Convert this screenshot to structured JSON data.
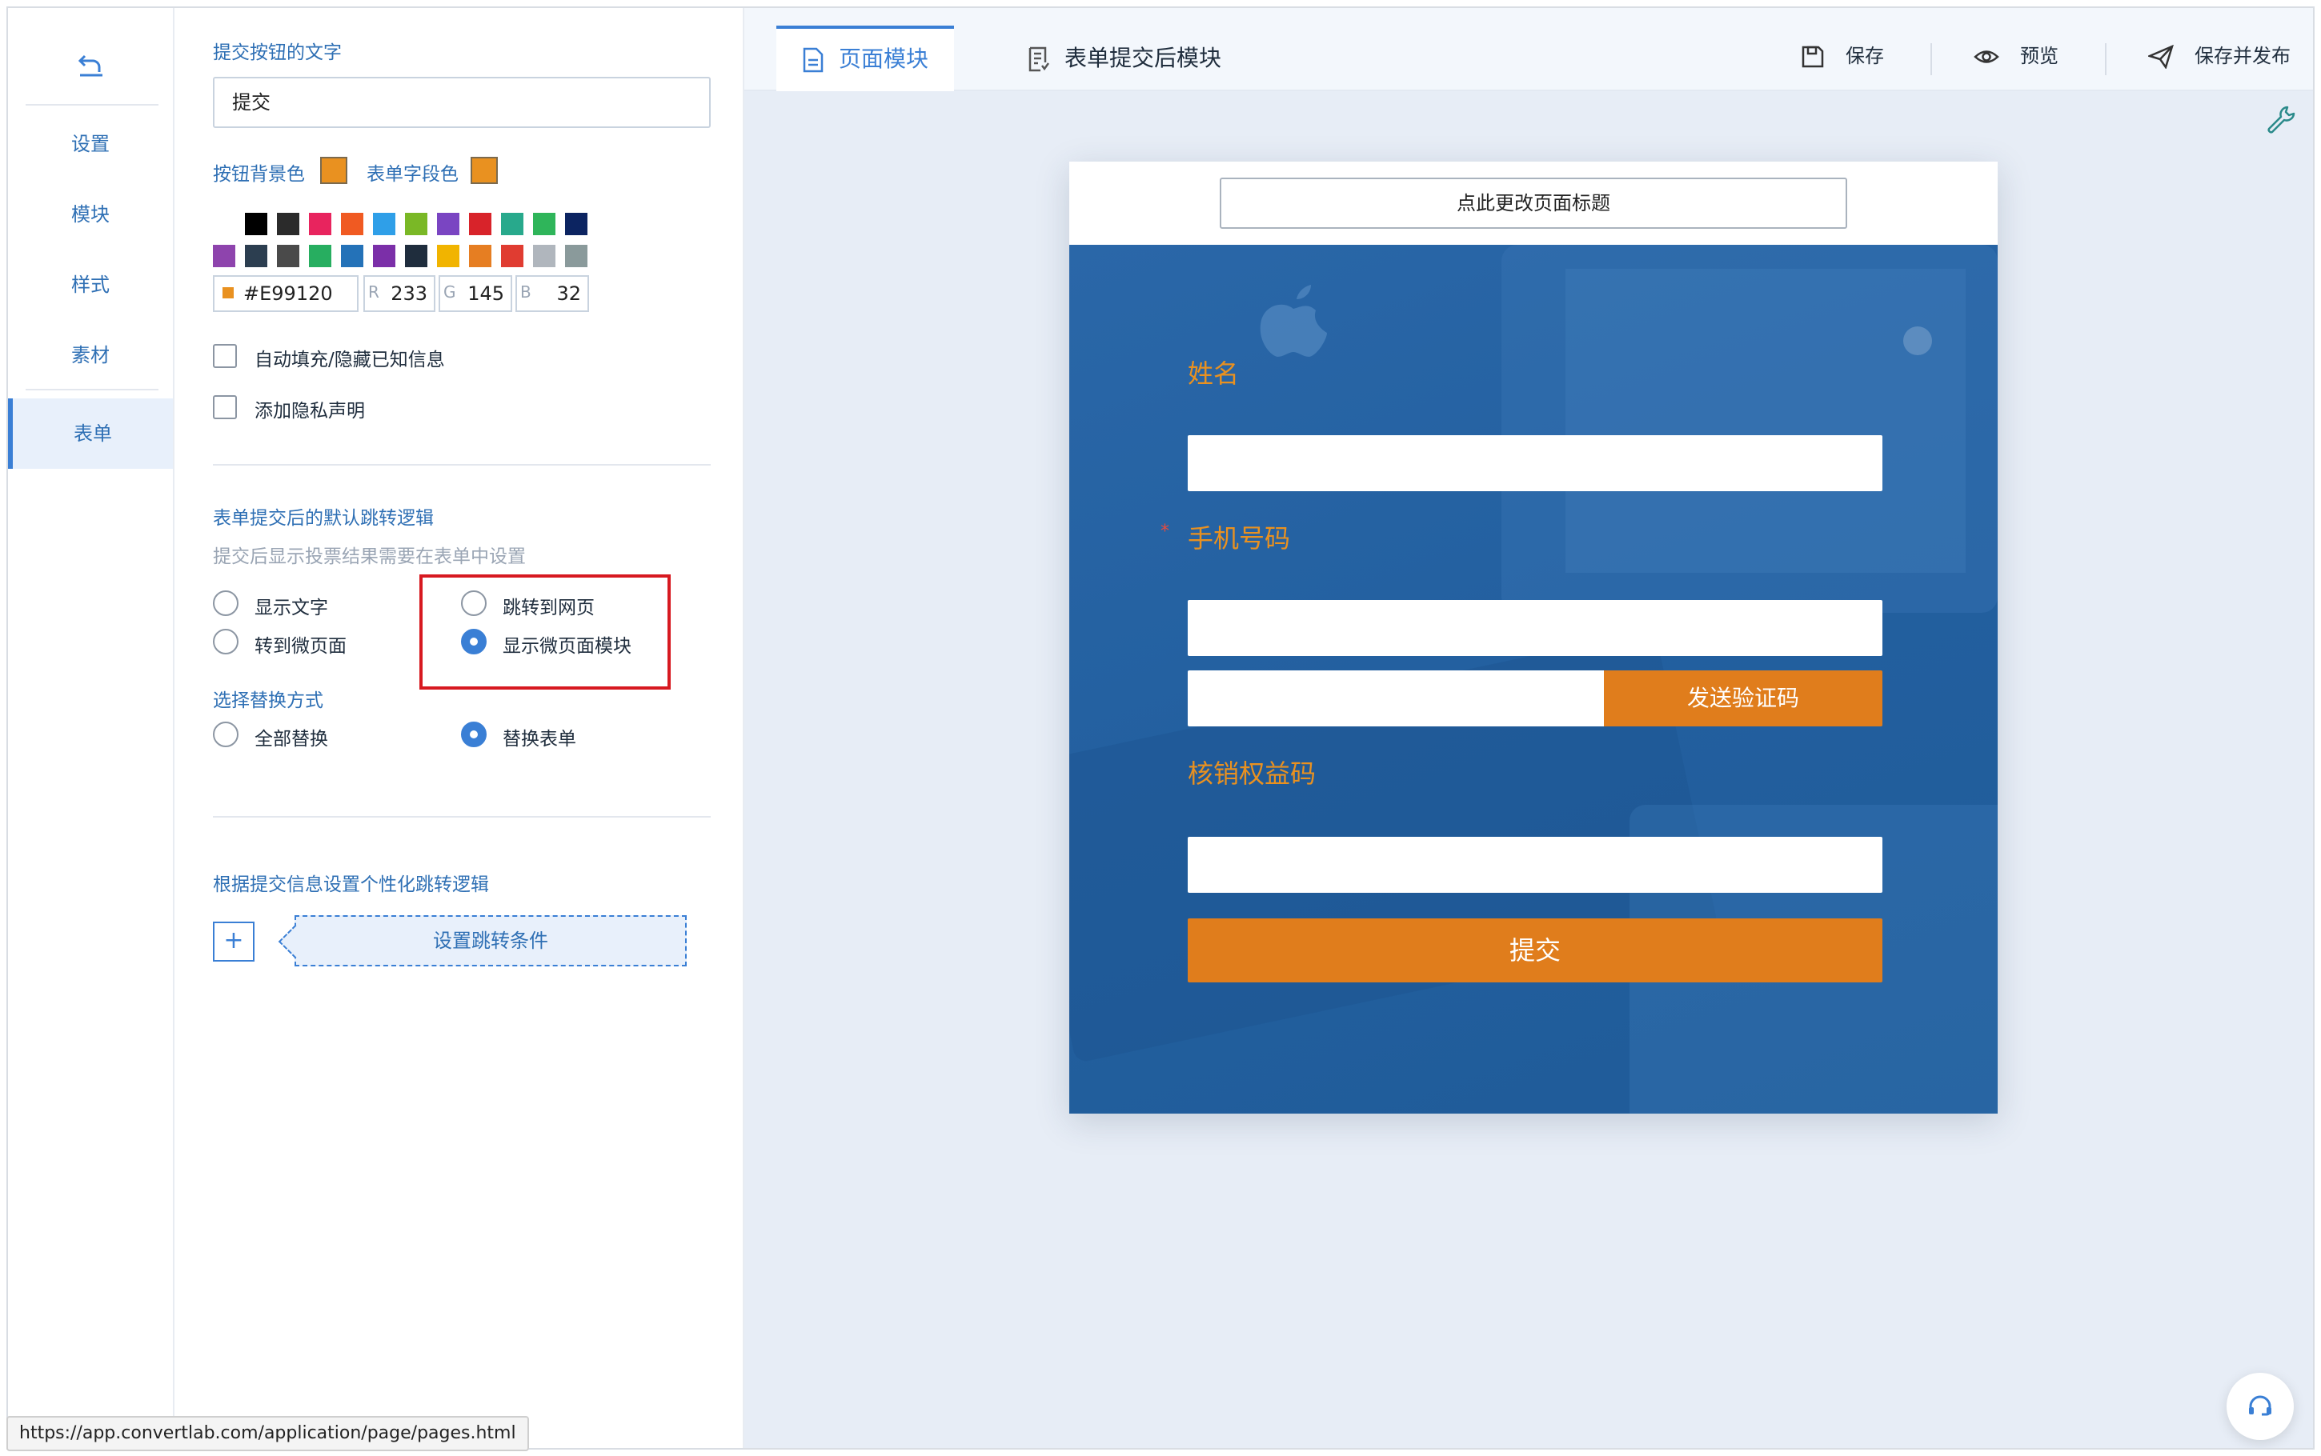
{
  "nav": {
    "items": [
      {
        "label": "设置"
      },
      {
        "label": "模块"
      },
      {
        "label": "样式"
      },
      {
        "label": "素材"
      },
      {
        "label": "表单",
        "active": true
      }
    ]
  },
  "panel": {
    "submit_text_label": "提交按钮的文字",
    "submit_text_value": "提交",
    "btn_bg_label": "按钮背景色",
    "field_color_label": "表单字段色",
    "btn_bg_color": "#E99120",
    "field_color": "#E99120",
    "palette_row1": [
      "#ffffff",
      "#000000",
      "#2b2b2b",
      "#e8245e",
      "#f05a22",
      "#2f9fe8",
      "#7ab826",
      "#7a45c2",
      "#d8232a",
      "#28a98c",
      "#2fb55a",
      "#0c2461"
    ],
    "palette_row2": [
      "#8e44ad",
      "#2c3e50",
      "#4a4a4a",
      "#27ae60",
      "#2472b8",
      "#7b2fa8",
      "#1f2d3d",
      "#f1b400",
      "#e67e22",
      "#e03c31",
      "#b0b6bd",
      "#8a9a9b"
    ],
    "hex_value": "#E99120",
    "r_label": "R",
    "r_value": "233",
    "g_label": "G",
    "g_value": "145",
    "b_label": "B",
    "b_value": "32",
    "autofill_label": "自动填充/隐藏已知信息",
    "privacy_label": "添加隐私声明",
    "redirect_title": "表单提交后的默认跳转逻辑",
    "redirect_hint": "提交后显示投票结果需要在表单中设置",
    "opt_show_text": "显示文字",
    "opt_goto_web": "跳转到网页",
    "opt_goto_micro": "转到微页面",
    "opt_show_module": "显示微页面模块",
    "replace_title": "选择替换方式",
    "opt_replace_all": "全部替换",
    "opt_replace_form": "替换表单",
    "personal_title": "根据提交信息设置个性化跳转逻辑",
    "plus_label": "+",
    "condition_btn": "设置跳转条件"
  },
  "toolbar": {
    "tab_page": "页面模块",
    "tab_after": "表单提交后模块",
    "save": "保存",
    "preview": "预览",
    "publish": "保存并发布"
  },
  "preview": {
    "title_btn": "点此更改页面标题",
    "name_label": "姓名",
    "phone_label": "手机号码",
    "required_mark": "*",
    "sms_btn": "发送验证码",
    "code_label": "核销权益码",
    "submit_btn": "提交"
  },
  "status_url": "https://app.convertlab.com/application/page/pages.html"
}
